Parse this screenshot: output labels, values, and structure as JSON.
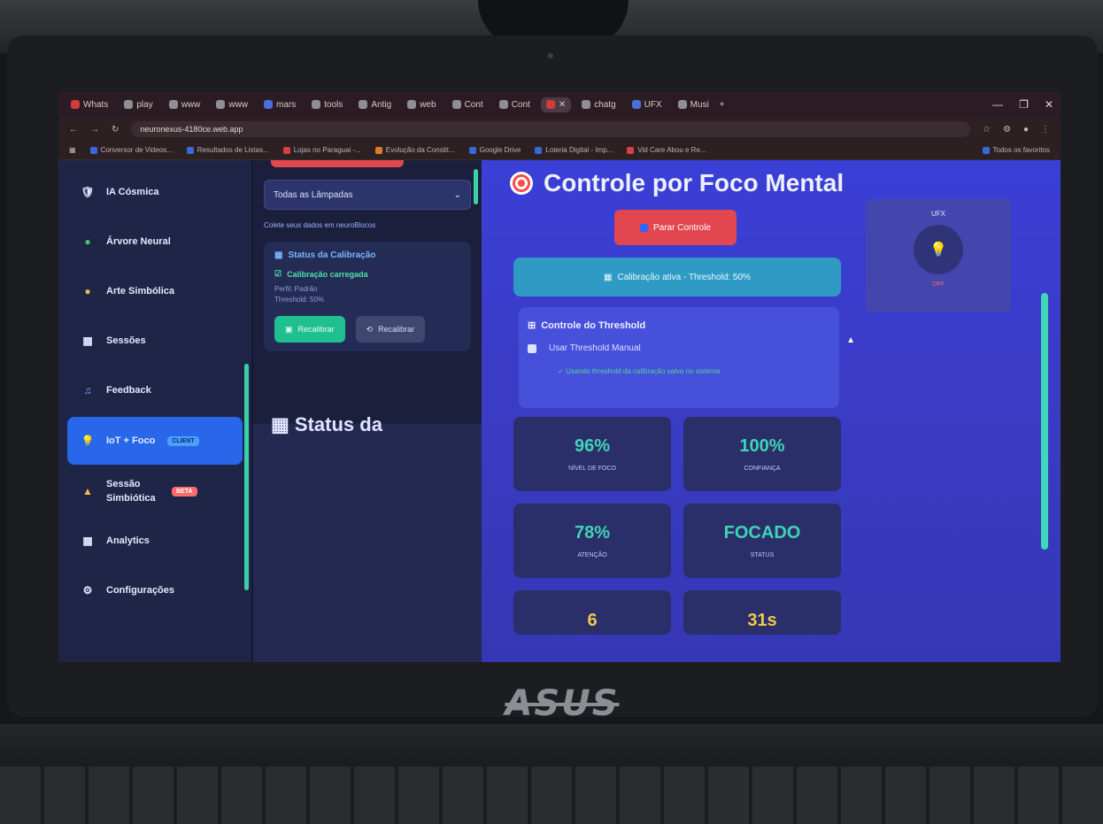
{
  "browser": {
    "tabs": [
      "Whats",
      "play",
      "www",
      "www",
      "mars",
      "tools",
      "Antig",
      "web",
      "Cont",
      "Cont",
      "",
      "chatg",
      "UFX",
      "Musi"
    ],
    "url": "neuronexus-4180ce.web.app",
    "bookmarks": [
      "Conversor de Videos...",
      "Resultados de Listas...",
      "Lojas no Paraguai -...",
      "Evolução da Constit...",
      "Google Drive",
      "Loteria Digital - Imp...",
      "Vid Care Abou e Re...",
      "Todos os favoritos"
    ]
  },
  "sidebar": {
    "items": [
      {
        "label": "IA Cósmica",
        "icon": "shield-icon"
      },
      {
        "label": "Árvore Neural",
        "icon": "tree-icon"
      },
      {
        "label": "Arte Simbólica",
        "icon": "palette-icon"
      },
      {
        "label": "Sessões",
        "icon": "list-icon"
      },
      {
        "label": "Feedback",
        "icon": "music-icon"
      },
      {
        "label": "IoT + Foco",
        "icon": "bulb-icon",
        "badge": "CLIENT",
        "active": true
      },
      {
        "label": "Sessão Simbiótica",
        "icon": "drop-icon",
        "badge": "BETA"
      },
      {
        "label": "Analytics",
        "icon": "chart-icon"
      },
      {
        "label": "Configurações",
        "icon": "gear-icon"
      }
    ]
  },
  "panel": {
    "select_value": "Todas as Lâmpadas",
    "hint": "Colete seus dados em neuroBlocos",
    "calibration_title": "Status da Calibração",
    "calibration_status": "Calibração carregada",
    "calibration_meta_1": "Perfil: Padrão",
    "calibration_meta_2": "Threshold: 50%",
    "btn_primary": "Recalibrar",
    "btn_secondary": "Recalibrar",
    "lower_heading": "Status da"
  },
  "main": {
    "title": "Controle por Foco Mental",
    "stop_button": "Parar Controle",
    "calibration_banner": "Calibração ativa - Threshold: 50%",
    "threshold_title": "Controle do Threshold",
    "threshold_checkbox": "Usar Threshold Manual",
    "threshold_note": "Usando threshold da calibração salva no sistema",
    "metrics": [
      {
        "value": "96%",
        "label": "NÍVEL DE FOCO",
        "color": "teal"
      },
      {
        "value": "100%",
        "label": "CONFIANÇA",
        "color": "teal"
      },
      {
        "value": "78%",
        "label": "ATENÇÃO",
        "color": "teal"
      },
      {
        "value": "FOCADO",
        "label": "STATUS",
        "color": "teal"
      },
      {
        "value": "6",
        "label": "",
        "color": "yellow"
      },
      {
        "value": "31s",
        "label": "",
        "color": "yellow"
      }
    ],
    "ufx_title": "UFX",
    "ufx_status": "OFF"
  },
  "colors": {
    "accent_blue": "#2866ea",
    "accent_teal": "#3fd4b6",
    "danger_red": "#e2474f"
  }
}
